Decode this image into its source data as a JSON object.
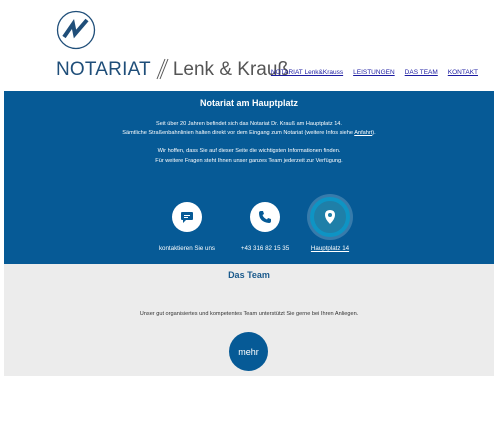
{
  "header": {
    "logo_notariat": "NOTARIAT",
    "logo_names": "Lenk & Krauß"
  },
  "nav": {
    "items": [
      {
        "label": "NOTARIAT Lenk&Krauss"
      },
      {
        "label": "LEISTUNGEN"
      },
      {
        "label": "DAS TEAM"
      },
      {
        "label": "KONTAKT"
      }
    ]
  },
  "hero": {
    "title": "Notariat am Hauptplatz",
    "p1_line1": "Seit über 20 Jahren befindet sich das Notariat Dr. Krauß am Hauptplatz 14.",
    "p1_line2_pre": "Sämtliche Straßenbahnlinien halten direkt vor dem Eingang zum Notariat (weitere Infos siehe ",
    "p1_link": "Anfahrt",
    "p1_line2_post": ").",
    "p2_line1": "Wir hoffen, dass Sie auf dieser Seite die wichtigsten Informationen finden.",
    "p2_line2": "Für weitere Fragen steht Ihnen unser ganzes Team jederzeit zur Verfügung."
  },
  "contacts": [
    {
      "label": "kontaktieren Sie uns",
      "icon": "chat-icon"
    },
    {
      "label": "+43 316 82 15 35",
      "icon": "phone-icon"
    },
    {
      "label": "Hauptplatz 14",
      "icon": "location-pin-icon"
    }
  ],
  "team": {
    "title": "Das Team",
    "text": "Unser gut organisiertes und kompetentes Team unterstützt Sie gerne bei Ihren Anliegen.",
    "button": "mehr"
  },
  "colors": {
    "primary": "#065a96",
    "accent": "#0e94c4",
    "logo": "#1f4e79",
    "team_bg": "#ececec"
  }
}
